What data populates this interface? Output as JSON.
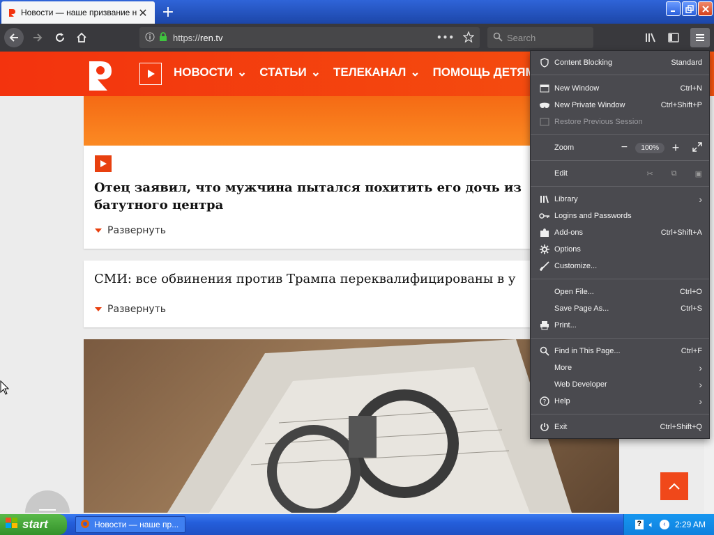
{
  "browser": {
    "tab_title": "Новости — наше призвание на РЕН ТВ",
    "new_tab": "+",
    "url_prefix": "https://",
    "url_host": "ren.tv",
    "search_placeholder": "Search",
    "window_buttons": [
      "minimize",
      "restore",
      "close"
    ]
  },
  "site": {
    "nav": [
      "НОВОСТИ",
      "СТАТЬИ",
      "ТЕЛЕКАНАЛ",
      "ПОМОЩЬ ДЕТЯМ"
    ],
    "articles": [
      {
        "headline": "Отец заявил, что мужчина пытался похитить его дочь из батутного центра",
        "expand": "Развернуть"
      },
      {
        "headline": "СМИ: все обвинения против Трампа переквалифицированы в у",
        "expand": "Развернуть"
      }
    ],
    "accent_color": "#f3330e"
  },
  "menu": {
    "content_blocking": {
      "label": "Content Blocking",
      "value": "Standard"
    },
    "new_window": {
      "label": "New Window",
      "shortcut": "Ctrl+N"
    },
    "new_private_window": {
      "label": "New Private Window",
      "shortcut": "Ctrl+Shift+P"
    },
    "restore_session": {
      "label": "Restore Previous Session"
    },
    "zoom": {
      "label": "Zoom",
      "value": "100%"
    },
    "edit": {
      "label": "Edit"
    },
    "library": {
      "label": "Library"
    },
    "logins": {
      "label": "Logins and Passwords"
    },
    "addons": {
      "label": "Add-ons",
      "shortcut": "Ctrl+Shift+A"
    },
    "options": {
      "label": "Options"
    },
    "customize": {
      "label": "Customize..."
    },
    "open_file": {
      "label": "Open File...",
      "shortcut": "Ctrl+O"
    },
    "save_page": {
      "label": "Save Page As...",
      "shortcut": "Ctrl+S"
    },
    "print": {
      "label": "Print..."
    },
    "find": {
      "label": "Find in This Page...",
      "shortcut": "Ctrl+F"
    },
    "more": {
      "label": "More"
    },
    "web_developer": {
      "label": "Web Developer"
    },
    "help": {
      "label": "Help"
    },
    "exit": {
      "label": "Exit",
      "shortcut": "Ctrl+Shift+Q"
    }
  },
  "taskbar": {
    "start": "start",
    "task_item": "Новости — наше пр...",
    "clock": "2:29 AM"
  }
}
